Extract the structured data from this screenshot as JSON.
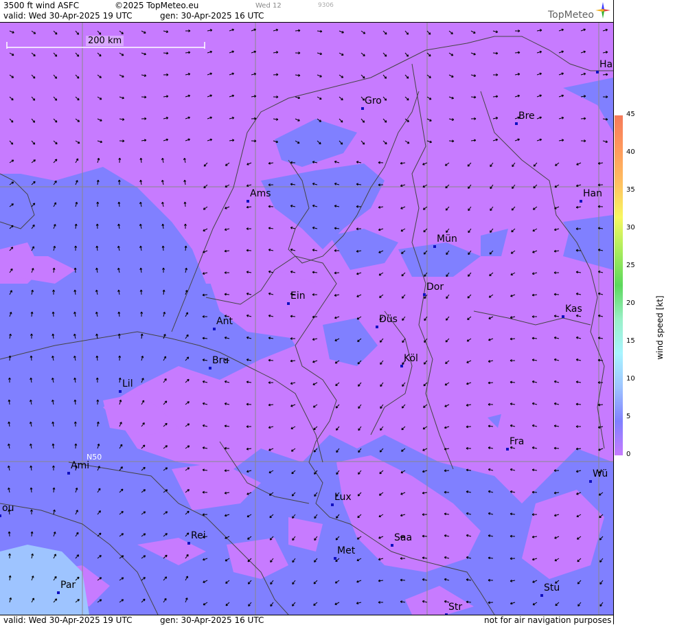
{
  "header": {
    "product": "3500 ft wind ASFC",
    "copyright": "©2025 TopMeteo.eu",
    "run_code": "Wed 12",
    "id_code": "9306",
    "valid": "valid:  Wed  30-Apr-2025  19 UTC",
    "gen": "gen:  30-Apr-2025 16 UTC",
    "logo": "TopMeteo"
  },
  "footer": {
    "valid": "valid:  Wed  30-Apr-2025  19 UTC",
    "gen": "gen: 30-Apr-2025 16 UTC",
    "disclaimer": "not for air navigation purposes"
  },
  "map": {
    "scale_label": "200 km",
    "lat_label": "N50",
    "cities": [
      {
        "name": "Gro"
      },
      {
        "name": "Bre"
      },
      {
        "name": "Ha"
      },
      {
        "name": "Ams"
      },
      {
        "name": "Han"
      },
      {
        "name": "Mün"
      },
      {
        "name": "Ein"
      },
      {
        "name": "Dor"
      },
      {
        "name": "Ant"
      },
      {
        "name": "Düs"
      },
      {
        "name": "Kas"
      },
      {
        "name": "Bru"
      },
      {
        "name": "Köl"
      },
      {
        "name": "Lil"
      },
      {
        "name": "Fra"
      },
      {
        "name": "Ami"
      },
      {
        "name": "Wü"
      },
      {
        "name": "Lux"
      },
      {
        "name": "ou"
      },
      {
        "name": "Rei"
      },
      {
        "name": "Saa"
      },
      {
        "name": "Met"
      },
      {
        "name": "Par"
      },
      {
        "name": "Stu"
      },
      {
        "name": "Str"
      }
    ]
  },
  "legend": {
    "title": "wind speed [kt]",
    "ticks": [
      "0",
      "5",
      "10",
      "15",
      "20",
      "25",
      "30",
      "35",
      "40",
      "45"
    ],
    "colors": [
      "#c77bff",
      "#8080ff",
      "#9ec4ff",
      "#a8f4ff",
      "#9af0c8",
      "#5cd85c",
      "#a8ec5c",
      "#f8f860",
      "#ffc060",
      "#ff9a5c",
      "#f57a5a"
    ]
  },
  "colors": {
    "calm": "#c77bff",
    "moderate": "#8080ff",
    "fresh": "#9ec4ff",
    "city_dot": "#1010c0"
  }
}
